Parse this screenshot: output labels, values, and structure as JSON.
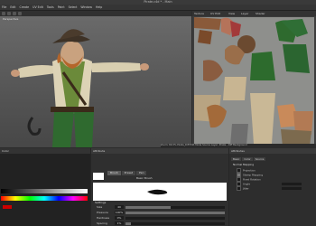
{
  "window": {
    "title": "Pirate.c4d * - Main"
  },
  "menu": [
    "File",
    "Edit",
    "Create",
    "UV Edit",
    "Tools",
    "Paint",
    "Select",
    "Window",
    "Help"
  ],
  "viewport": {
    "label": "Perspective"
  },
  "uv_panel": {
    "tabs": [
      "Texture",
      "UV Edit",
      "View",
      "Layer",
      "Shader"
    ],
    "footer": "Zoom: 89.3%   Pirate_Diff  Edit Mode  Source Layer: Pirate - Diff Background"
  },
  "color_panel": {
    "title": "Color",
    "accent": "#cc0000"
  },
  "brush_panel": {
    "title": "Attribute",
    "tabs": [
      "Brush",
      "Preset",
      "Pen"
    ],
    "label_shape": "Size",
    "preset_label": "Basic Brush",
    "settings_title": "Settings",
    "rows": [
      {
        "label": "Size",
        "value": "40",
        "level": 0.45
      },
      {
        "label": "Pressure",
        "value": "100%",
        "level": 1.0
      },
      {
        "label": "Hardness",
        "value": "0%",
        "level": 0.0
      },
      {
        "label": "Spacing",
        "value": "1%",
        "level": 0.05
      }
    ]
  },
  "attr_panel": {
    "title": "Attributes",
    "tabs": [
      "Basic",
      "Color",
      "Source"
    ],
    "section": "Normal Mapping",
    "options": [
      {
        "label": "Projection",
        "checked": false
      },
      {
        "label": "Stamp Mapping",
        "checked": true
      },
      {
        "label": "Fixed Rotation",
        "checked": false
      },
      {
        "label": "Angle",
        "checked": false
      },
      {
        "label": "Jitter",
        "checked": false
      }
    ]
  }
}
